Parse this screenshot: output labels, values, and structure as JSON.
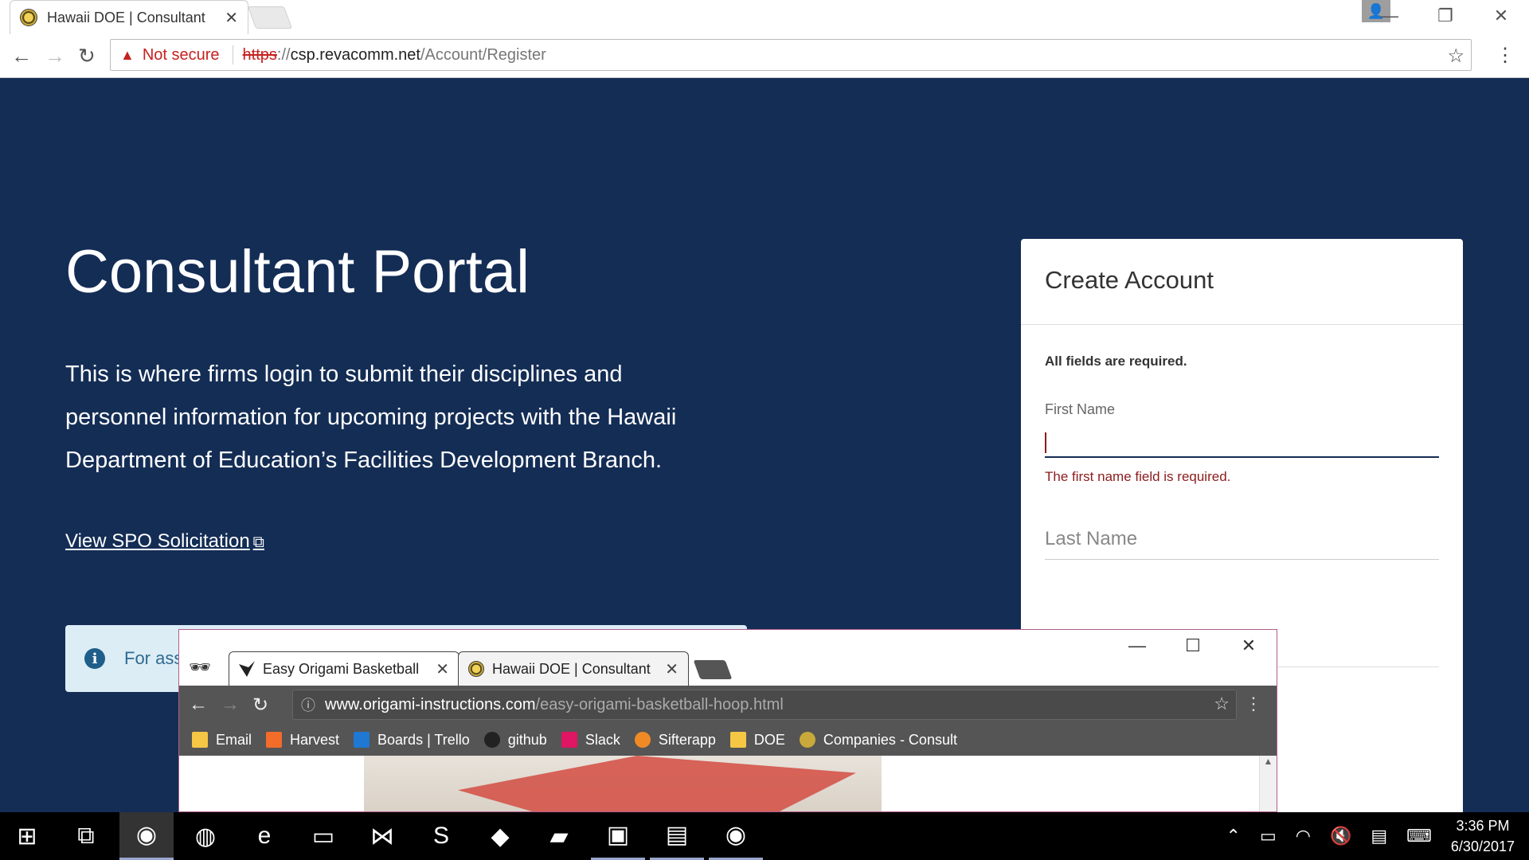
{
  "browser": {
    "tab_title": "Hawaii DOE | Consultant",
    "tab_close": "✕",
    "not_secure": "Not secure",
    "url_scheme": "https",
    "url_scheme_rest": "://",
    "url_host": "csp.revacomm.net",
    "url_path": "/Account/Register"
  },
  "page": {
    "title": "Consultant Portal",
    "description": "This is where firms login to submit their disciplines and personnel information for upcoming projects with the Hawaii Department of Education’s Facilities Development Branch.",
    "spo_link": "View SPO Solicitation",
    "info_text": "For ass"
  },
  "form": {
    "title": "Create Account",
    "note": "All fields are required.",
    "first_name_label": "First Name",
    "first_name_error": "The first name field is required.",
    "last_name_placeholder": "Last Name"
  },
  "window2": {
    "tabs": [
      {
        "title": "Easy Origami Basketball |"
      },
      {
        "title": "Hawaii DOE | Consultant"
      }
    ],
    "url_host": "www.origami-instructions.com",
    "url_path": "/easy-origami-basketball-hoop.html",
    "bookmarks": [
      {
        "label": "Email",
        "color": "#f6c744"
      },
      {
        "label": "Harvest",
        "color": "#f26c2a"
      },
      {
        "label": "Boards | Trello",
        "color": "#1f78d1"
      },
      {
        "label": "github",
        "color": "#222222"
      },
      {
        "label": "Slack",
        "color": "#e01563"
      },
      {
        "label": "Sifterapp",
        "color": "#f08a24"
      },
      {
        "label": "DOE",
        "color": "#f6c744"
      },
      {
        "label": "Companies - Consult",
        "color": "#c9a93a"
      }
    ]
  },
  "taskbar": {
    "time": "3:36 PM",
    "date": "6/30/2017"
  }
}
